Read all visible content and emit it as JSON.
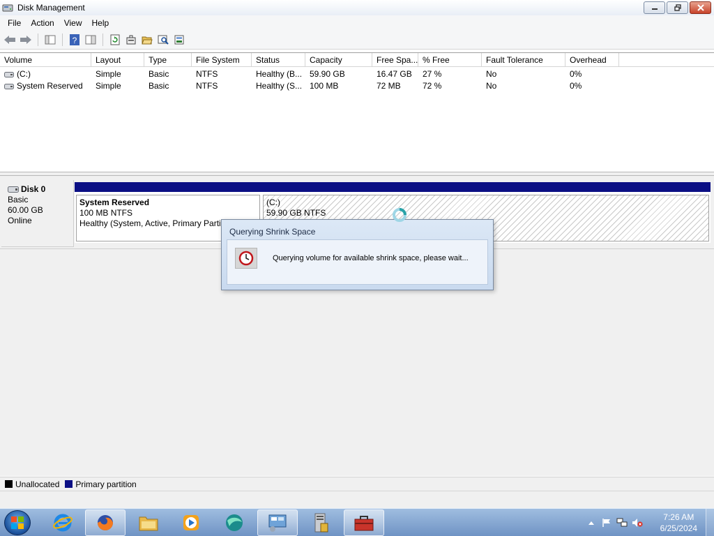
{
  "window": {
    "title": "Disk Management",
    "icon": "disk-management-icon"
  },
  "menu": [
    "File",
    "Action",
    "View",
    "Help"
  ],
  "toolbar": {
    "buttons": [
      "back-icon",
      "forward-icon",
      "show-hide-console-tree-icon",
      "help-icon",
      "console-icon",
      "refresh-icon",
      "properties-icon",
      "open-icon",
      "explore-icon",
      "rescan-icon"
    ]
  },
  "volume_list": {
    "columns": [
      "Volume",
      "Layout",
      "Type",
      "File System",
      "Status",
      "Capacity",
      "Free Spa...",
      "% Free",
      "Fault Tolerance",
      "Overhead"
    ],
    "rows": [
      [
        "(C:)",
        "Simple",
        "Basic",
        "NTFS",
        "Healthy (B...",
        "59.90 GB",
        "16.47 GB",
        "27 %",
        "No",
        "0%"
      ],
      [
        "System Reserved",
        "Simple",
        "Basic",
        "NTFS",
        "Healthy (S...",
        "100 MB",
        "72 MB",
        "72 %",
        "No",
        "0%"
      ]
    ]
  },
  "disk": {
    "name": "Disk 0",
    "type": "Basic",
    "size": "60.00 GB",
    "status": "Online",
    "partitions": [
      {
        "title": "System Reserved",
        "size_fs": "100 MB NTFS",
        "status": "Healthy (System, Active, Primary Partition)"
      },
      {
        "title": "(C:)",
        "size_fs": "59.90 GB NTFS",
        "status": ""
      }
    ]
  },
  "legend": {
    "items": [
      {
        "label": "Unallocated",
        "color": "#000000"
      },
      {
        "label": "Primary partition",
        "color": "#0b0f84"
      }
    ]
  },
  "dialog": {
    "title": "Querying Shrink Space",
    "message": "Querying volume for available shrink space, please wait..."
  },
  "taskbar": {
    "apps": [
      "internet-explorer-icon",
      "firefox-icon",
      "file-explorer-icon",
      "media-player-icon",
      "browser-icon",
      "control-panel-icon",
      "server-manager-icon",
      "toolbox-icon"
    ],
    "time": "7:26 AM",
    "date": "6/25/2024"
  },
  "colors": {
    "primary_partition": "#0b0f84",
    "taskbar": "#6f93c4"
  }
}
